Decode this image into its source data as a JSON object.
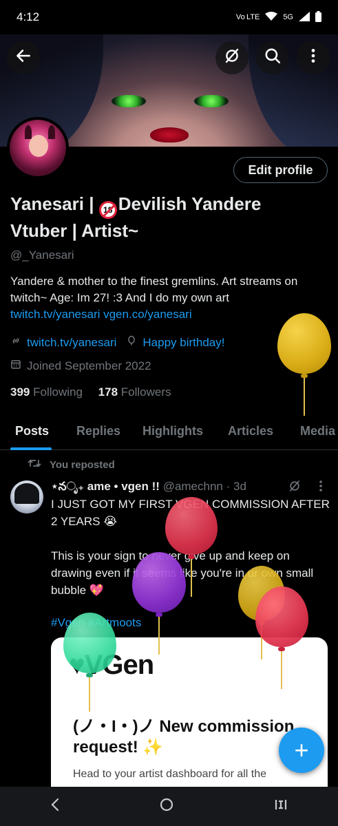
{
  "status_bar": {
    "time": "4:12",
    "network": "Vo LTE",
    "signal": "5G"
  },
  "header": {
    "back_icon": "arrow-left-icon",
    "grok_icon": "grok-icon",
    "search_icon": "search-icon",
    "more_icon": "more-vertical-icon"
  },
  "profile": {
    "edit_label": "Edit profile",
    "name_part1": "Yanesari | ",
    "age_badge": "18",
    "name_part2": "Devilish Yandere Vtuber | Artist~",
    "handle": "@_Yanesari",
    "bio": "Yandere & mother to the finest gremlins. Art streams on twitch~ Age: Im 27! :3 And I do my own art",
    "bio_links": "twitch.tv/yanesari vgen.co/yanesari",
    "website": "twitch.tv/yanesari",
    "birthday": "Happy birthday!",
    "joined": "Joined September 2022",
    "following_count": "399",
    "following_label": "Following",
    "followers_count": "178",
    "followers_label": "Followers"
  },
  "tabs": [
    "Posts",
    "Replies",
    "Highlights",
    "Articles",
    "Media"
  ],
  "post": {
    "repost_label": "You reposted",
    "author": "⋆నೃ₊ ame • vgen !!",
    "handle_time": "@amechnn · 3d",
    "text": "I JUST GOT MY FIRST VGEN COMMISSION AFTER 2 YEARS 😭\n\nThis is your sign to never give up and keep on drawing even if it seems like you're in ur own small bubble 💖",
    "hashtags": "#Vgen #Artmoots",
    "card": {
      "logo_text": "VGen",
      "title": "(ノ・Ι・)ノ New commission request! ✨",
      "desc": "Head to your artist dashboard for all the"
    }
  },
  "fab_label": "+",
  "nav": {
    "back": "‹",
    "home": "○",
    "recents": "|||"
  },
  "colors": {
    "accent": "#1d9bf0",
    "background": "#000000",
    "muted": "#71767b"
  }
}
